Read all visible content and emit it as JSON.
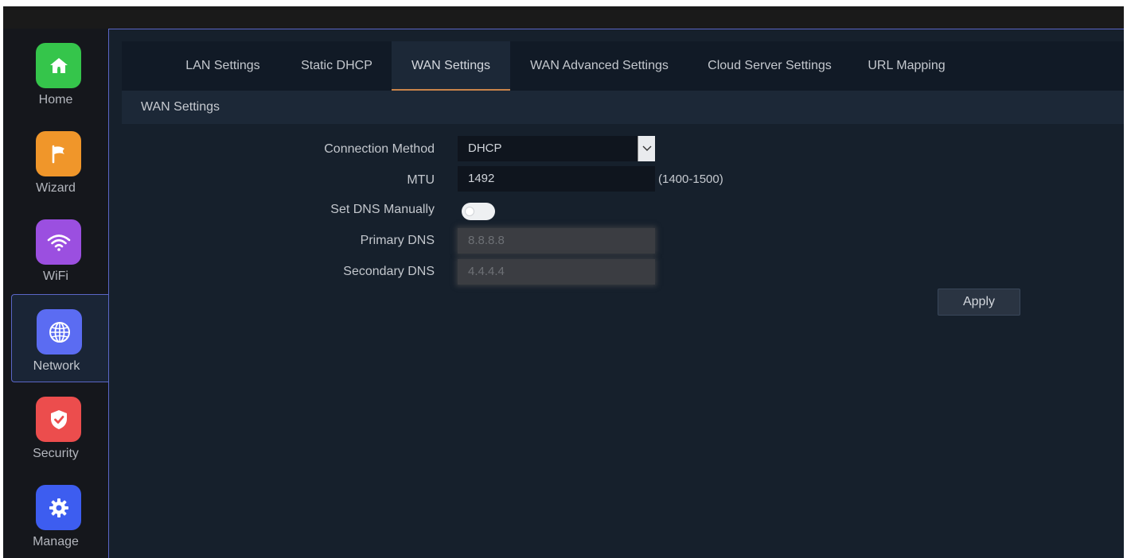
{
  "sidebar": {
    "items": [
      {
        "label": "Home",
        "icon": "home-icon",
        "color": "#35c54b"
      },
      {
        "label": "Wizard",
        "icon": "flag-icon",
        "color": "#f0962a"
      },
      {
        "label": "WiFi",
        "icon": "wifi-icon",
        "color": "#9b4fe0"
      },
      {
        "label": "Network",
        "icon": "globe-icon",
        "color": "#5b6cf2",
        "active": true
      },
      {
        "label": "Security",
        "icon": "shield-icon",
        "color": "#ec4d4d"
      },
      {
        "label": "Manage",
        "icon": "gear-icon",
        "color": "#3d5df0"
      }
    ]
  },
  "tabs": [
    {
      "label": "LAN Settings"
    },
    {
      "label": "Static DHCP"
    },
    {
      "label": "WAN Settings",
      "active": true
    },
    {
      "label": "WAN Advanced Settings"
    },
    {
      "label": "Cloud Server Settings"
    },
    {
      "label": "URL Mapping"
    }
  ],
  "section": {
    "title": "WAN Settings"
  },
  "form": {
    "connection_method": {
      "label": "Connection Method",
      "value": "DHCP"
    },
    "mtu": {
      "label": "MTU",
      "value": "1492",
      "hint": "(1400-1500)"
    },
    "set_dns_manually": {
      "label": "Set DNS Manually",
      "enabled": false
    },
    "primary_dns": {
      "label": "Primary DNS",
      "value": "8.8.8.8",
      "disabled": true
    },
    "secondary_dns": {
      "label": "Secondary DNS",
      "value": "4.4.4.4",
      "disabled": true
    }
  },
  "actions": {
    "apply_label": "Apply"
  },
  "colors": {
    "accent": "#c9844a",
    "frame_border": "#5a66c6"
  }
}
